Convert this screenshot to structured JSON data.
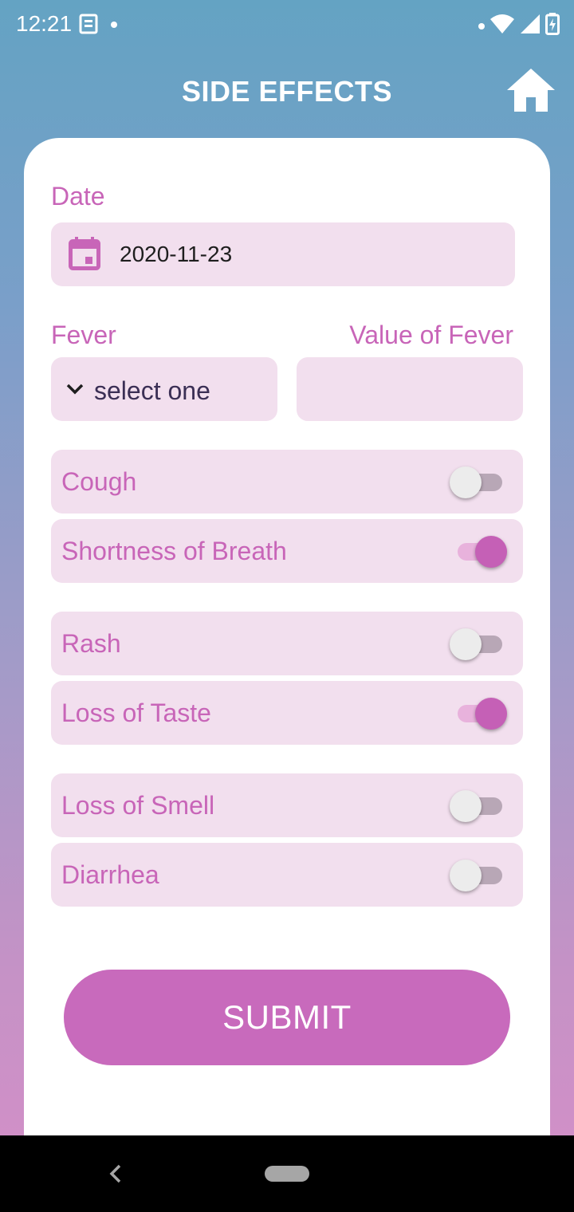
{
  "status_bar": {
    "time": "12:21"
  },
  "header": {
    "title": "SIDE EFFECTS"
  },
  "form": {
    "date_label": "Date",
    "date_value": "2020-11-23",
    "fever_label": "Fever",
    "fever_value_label": "Value of Fever",
    "fever_select_value": "select one",
    "fever_value_input": ""
  },
  "toggles": [
    {
      "label": "Cough",
      "on": false
    },
    {
      "label": "Shortness of Breath",
      "on": true
    },
    {
      "label": "Rash",
      "on": false
    },
    {
      "label": "Loss of Taste",
      "on": true
    },
    {
      "label": "Loss of Smell",
      "on": false
    },
    {
      "label": "Diarrhea",
      "on": false
    }
  ],
  "submit_label": "SUBMIT",
  "colors": {
    "accent": "#c865b8",
    "field_bg": "#f2dfee",
    "button": "#c86abc"
  },
  "icons": [
    "news-icon",
    "wifi-icon",
    "signal-icon",
    "battery-icon",
    "home-icon",
    "calendar-icon",
    "chevron-down-icon",
    "back-icon"
  ]
}
